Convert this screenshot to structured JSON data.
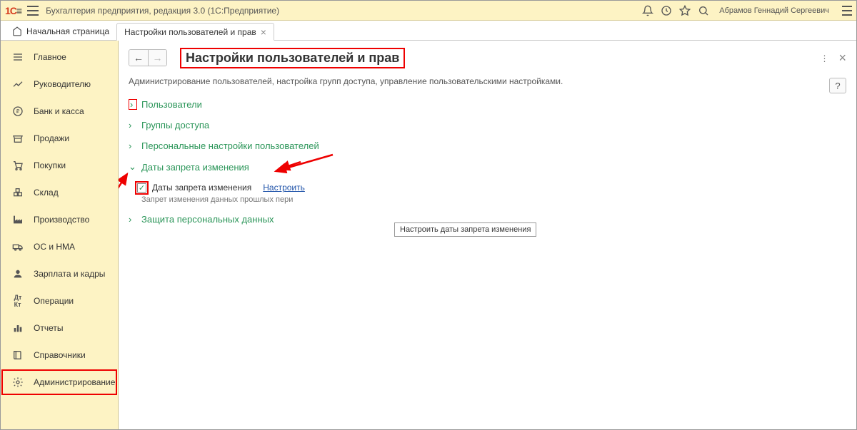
{
  "app": {
    "title": "Бухгалтерия предприятия, редакция 3.0  (1С:Предприятие)",
    "user": "Абрамов Геннадий Сергеевич"
  },
  "tabs": {
    "home": "Начальная страница",
    "active": "Настройки пользователей и прав"
  },
  "sidebar": {
    "items": [
      {
        "label": "Главное"
      },
      {
        "label": "Руководителю"
      },
      {
        "label": "Банк и касса"
      },
      {
        "label": "Продажи"
      },
      {
        "label": "Покупки"
      },
      {
        "label": "Склад"
      },
      {
        "label": "Производство"
      },
      {
        "label": "ОС и НМА"
      },
      {
        "label": "Зарплата и кадры"
      },
      {
        "label": "Операции"
      },
      {
        "label": "Отчеты"
      },
      {
        "label": "Справочники"
      },
      {
        "label": "Администрирование"
      }
    ]
  },
  "page": {
    "title": "Настройки пользователей и прав",
    "description": "Администрирование пользователей, настройка групп доступа, управление пользовательскими настройками.",
    "sections": {
      "users": "Пользователи",
      "groups": "Группы доступа",
      "personal": "Персональные настройки пользователей",
      "dates": "Даты запрета изменения",
      "protection": "Защита персональных данных"
    },
    "dates_block": {
      "checkbox_label": "Даты запрета изменения",
      "configure": "Настроить",
      "desc_prefix": "Запрет изменения данных прошлых пери",
      "tooltip": "Настроить даты запрета изменения"
    },
    "help": "?"
  }
}
